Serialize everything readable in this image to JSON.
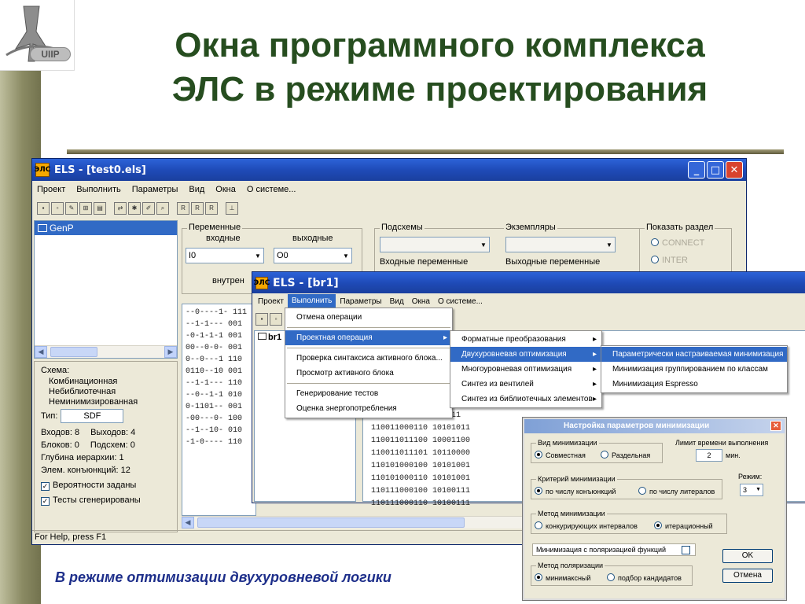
{
  "slide": {
    "title_line1": "Окна программного комплекса",
    "title_line2": "ЭЛС в режиме проектирования",
    "caption": "В режиме оптимизации двухуровневой логики",
    "logo_text": "UIIP",
    "title_color": "#264d1f",
    "caption_color": "#1d2e8a"
  },
  "main_window": {
    "title": "ELS - [test0.els]",
    "icon": "ЭЛС",
    "menu": [
      "Проект",
      "Выполнить",
      "Параметры",
      "Вид",
      "Окна",
      "О системе..."
    ],
    "tree_item": "GenP",
    "vars": {
      "group_label": "Переменные",
      "input_label": "входные",
      "output_label": "выходные",
      "input_value": "I0",
      "output_value": "O0",
      "internal_label": "внутрен"
    },
    "subcircuits": {
      "group_label": "Подсхемы",
      "inputs_label": "Входные переменные"
    },
    "instances": {
      "group_label": "Экземпляры",
      "outputs_label": "Выходные переменные"
    },
    "show_section": {
      "group_label": "Показать раздел",
      "options": [
        "CONNECT",
        "INTER"
      ]
    },
    "truth_table": [
      "--0----1- 111",
      "--1-1--- 001",
      "-0-1-1-1 001",
      "00--0-0- 001",
      "0--0---1 110",
      "0110--10 001",
      "--1-1--- 110",
      "--0--1-1 010",
      "0-1101-- 001",
      "-00---0- 100",
      "--1--10- 010",
      "-1-0---- 110"
    ],
    "info": {
      "scheme_label": "Схема:",
      "scheme_lines": [
        "Комбинационная",
        "Небиблиотечная",
        "Неминимизированная"
      ],
      "type_label": "Тип:",
      "type_value": "SDF",
      "inputs": "Входов: 8",
      "outputs": "Выходов: 4",
      "blocks": "Блоков: 0",
      "subcircuits": "Подсхем: 0",
      "depth": "Глубина иерархии:  1",
      "conj": "Элем. конъюнкций:  12",
      "check1": "Вероятности заданы",
      "check2": "Тесты сгенерированы"
    },
    "status": "For Help, press F1"
  },
  "child_window": {
    "title": "ELS - [br1]",
    "icon": "ЭЛС",
    "menu": [
      "Проект",
      "Выполнить",
      "Параметры",
      "Вид",
      "Окна",
      "О системе..."
    ],
    "tree_item": "br1",
    "rows": [
      "1011",
      "110011000110  10101011",
      "110011011100  10001100",
      "110011011101  10110000",
      "110101000100  10101001",
      "110101000110  10101001",
      "110111000100  10100111",
      "110111000110  10100111"
    ]
  },
  "menus": {
    "run": [
      "Отмена операции",
      "Проектная операция",
      "Проверка синтаксиса активного блока...",
      "Просмотр активного блока",
      "Генерирование тестов",
      "Оценка энергопотребления"
    ],
    "design": [
      "Форматные преобразования",
      "Двухуровневая оптимизация",
      "Многоуровневая оптимизация",
      "Синтез из вентилей",
      "Синтез из библиотечных элементов"
    ],
    "twolevel": [
      "Параметрически настраиваемая минимизация",
      "Минимизация группированием по классам",
      "Минимизация Espresso"
    ]
  },
  "dialog": {
    "title": "Настройка параметров минимизации",
    "kind_label": "Вид минимизации",
    "kind_options": [
      "Совместная",
      "Раздельная"
    ],
    "time_label": "Лимит времени выполнения",
    "time_value": "2",
    "time_unit": "мин.",
    "criterion_label": "Критерий минимизации",
    "criterion_options": [
      "по числу конъюнкций",
      "по числу литералов"
    ],
    "mode_label": "Режим:",
    "mode_value": "3",
    "method_label": "Метод минимизации",
    "method_options": [
      "конкурирующих интервалов",
      "итерационный"
    ],
    "polar_check": "Минимизация с поляризацией функций",
    "polar_method_label": "Метод поляризации",
    "polar_options": [
      "минимаксный",
      "подбор кандидатов"
    ],
    "ok": "OK",
    "cancel": "Отмена"
  }
}
